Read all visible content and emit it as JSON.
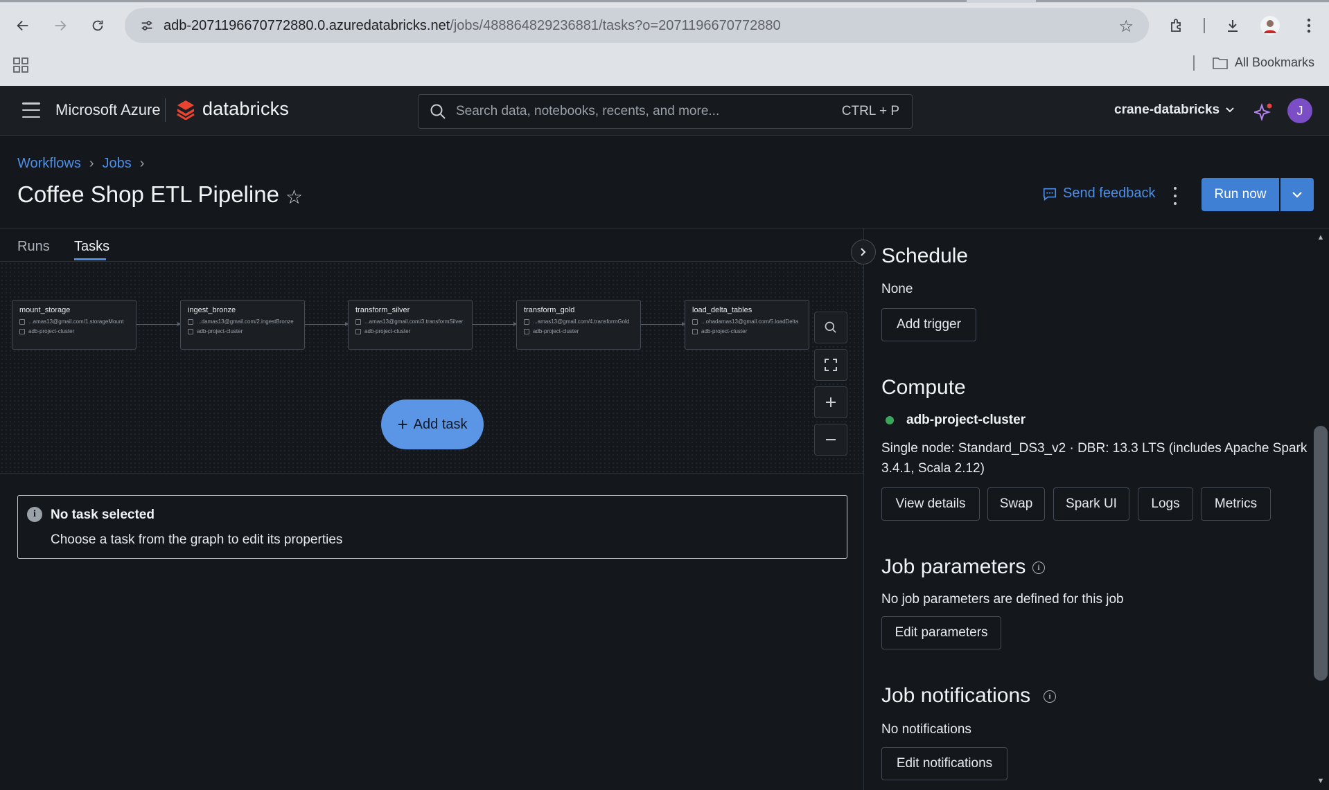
{
  "browser": {
    "url_host": "adb-2071196670772880.0.azuredatabricks.net",
    "url_path": "/jobs/488864829236881/tasks?o=2071196670772880",
    "bookmarks_label": "All Bookmarks"
  },
  "header": {
    "brand_ms": "Microsoft Azure",
    "brand_db": "databricks",
    "search_placeholder": "Search data, notebooks, recents, and more...",
    "search_shortcut": "CTRL + P",
    "workspace": "crane-databricks",
    "avatar_initial": "J"
  },
  "breadcrumb": [
    "Workflows",
    "Jobs"
  ],
  "page": {
    "title": "Coffee Shop ETL Pipeline",
    "feedback_label": "Send feedback",
    "run_now_label": "Run now"
  },
  "tabs": [
    "Runs",
    "Tasks"
  ],
  "graph": {
    "nodes": [
      {
        "name": "mount_storage",
        "path": "...amas13@gmail.com/1.storageMount",
        "cluster": "adb-project-cluster"
      },
      {
        "name": "ingest_bronze",
        "path": "...damas13@gmail.com/2.ingestBronze",
        "cluster": "adb-project-cluster"
      },
      {
        "name": "transform_silver",
        "path": "...amas13@gmail.com/3.transformSilver",
        "cluster": "adb-project-cluster"
      },
      {
        "name": "transform_gold",
        "path": "...amas13@gmail.com/4.transformGold",
        "cluster": "adb-project-cluster"
      },
      {
        "name": "load_delta_tables",
        "path": "...ohadamas13@gmail.com/5.loadDelta",
        "cluster": "adb-project-cluster"
      }
    ],
    "add_task_label": "Add task"
  },
  "no_task": {
    "title": "No task selected",
    "text": "Choose a task from the graph to edit its properties"
  },
  "right_panel": {
    "schedule": {
      "heading": "Schedule",
      "value": "None",
      "button": "Add trigger"
    },
    "compute": {
      "heading": "Compute",
      "cluster_name": "adb-project-cluster",
      "cluster_status_color": "#3ba55c",
      "details_line1": "Single node: Standard_DS3_v2 · DBR: 13.3 LTS (includes Apache Spark",
      "details_line2": "3.4.1, Scala 2.12)",
      "buttons": [
        "View details",
        "Swap",
        "Spark UI",
        "Logs",
        "Metrics"
      ]
    },
    "job_parameters": {
      "heading": "Job parameters",
      "text": "No job parameters are defined for this job",
      "button": "Edit parameters"
    },
    "job_notifications": {
      "heading": "Job notifications",
      "text": "No notifications",
      "button": "Edit notifications"
    }
  },
  "colors": {
    "accent": "#4c8ee8",
    "run_button": "#3f7fd4",
    "background": "#14181d"
  }
}
